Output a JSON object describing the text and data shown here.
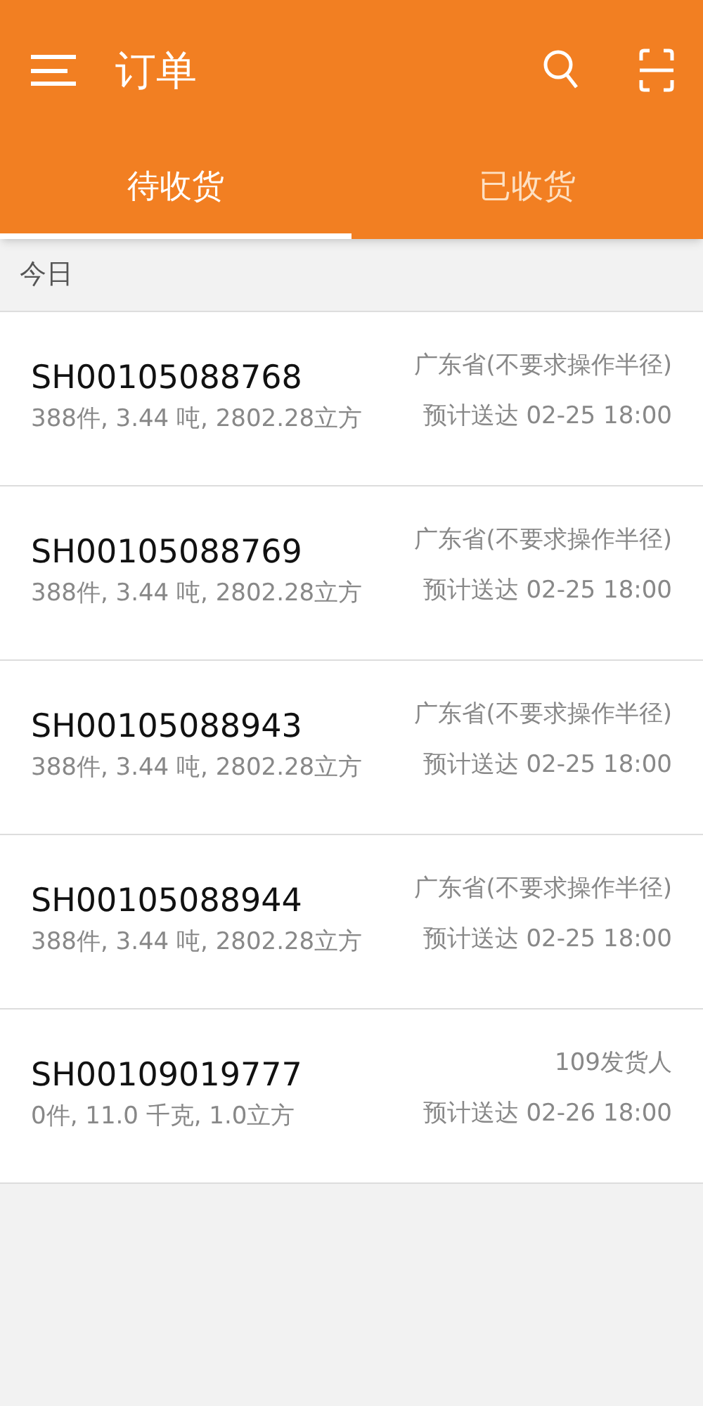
{
  "app_bar": {
    "title": "订单"
  },
  "tabs": [
    {
      "label": "待收货",
      "selected": true
    },
    {
      "label": "已收货",
      "selected": false
    }
  ],
  "section": {
    "label": "今日"
  },
  "orders": [
    {
      "number": "SH00105088768",
      "summary": "388件, 3.44 吨, 2802.28立方",
      "location": "广东省(不要求操作半径)",
      "eta": "预计送达 02-25 18:00"
    },
    {
      "number": "SH00105088769",
      "summary": "388件, 3.44 吨, 2802.28立方",
      "location": "广东省(不要求操作半径)",
      "eta": "预计送达 02-25 18:00"
    },
    {
      "number": "SH00105088943",
      "summary": "388件, 3.44 吨, 2802.28立方",
      "location": "广东省(不要求操作半径)",
      "eta": "预计送达 02-25 18:00"
    },
    {
      "number": "SH00105088944",
      "summary": "388件, 3.44 吨, 2802.28立方",
      "location": "广东省(不要求操作半径)",
      "eta": "预计送达 02-25 18:00"
    },
    {
      "number": "SH00109019777",
      "summary": "0件, 11.0 千克, 1.0立方",
      "location": "109发货人",
      "eta": "预计送达 02-26 18:00"
    }
  ]
}
